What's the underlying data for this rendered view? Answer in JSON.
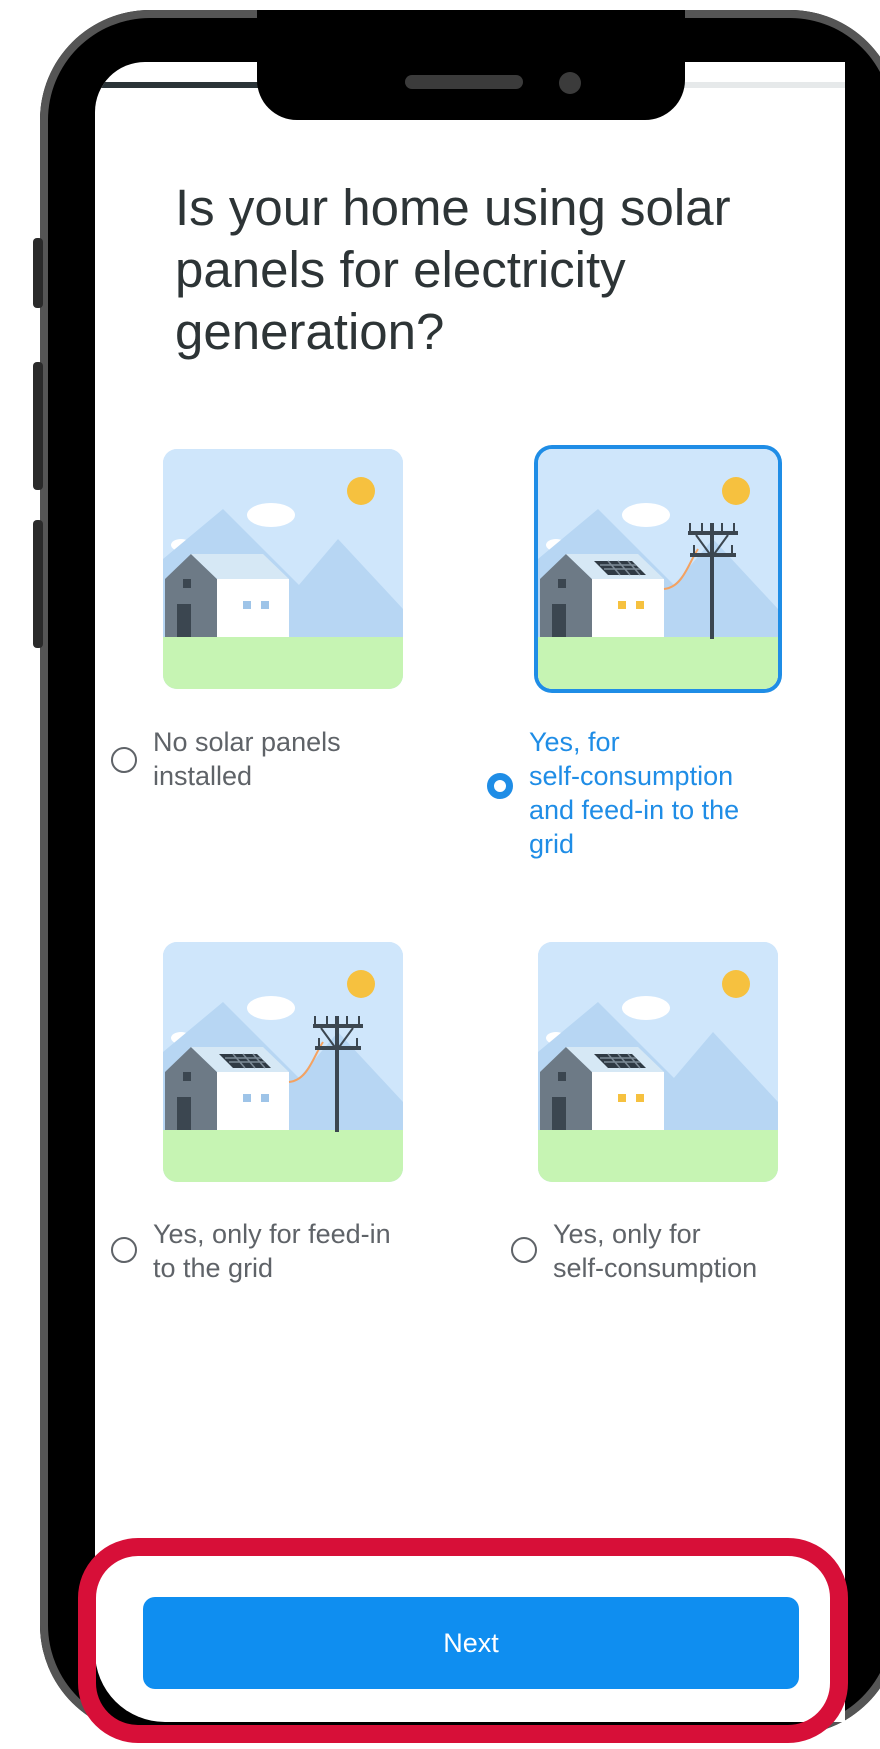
{
  "question": {
    "line1": "Is your home using solar",
    "line2": "panels for electricity",
    "line3": "generation?"
  },
  "options": [
    {
      "line1": "No solar panels",
      "line2": "installed",
      "selected": false
    },
    {
      "line1": "Yes, for",
      "line2": "self-consumption",
      "line3": "and feed-in to the",
      "line4": "grid",
      "selected": true
    },
    {
      "line1": "Yes, only for feed-in",
      "line2": "to the grid",
      "selected": false
    },
    {
      "line1": "Yes, only for",
      "line2": "self-consumption",
      "selected": false
    }
  ],
  "next_label": "Next",
  "colors": {
    "accent": "#1f8de6",
    "button": "#0f8ef0",
    "highlight": "#d70f38",
    "sky": "#cfe6fb",
    "grass": "#c6f4b3",
    "sun": "#f6c13f"
  }
}
